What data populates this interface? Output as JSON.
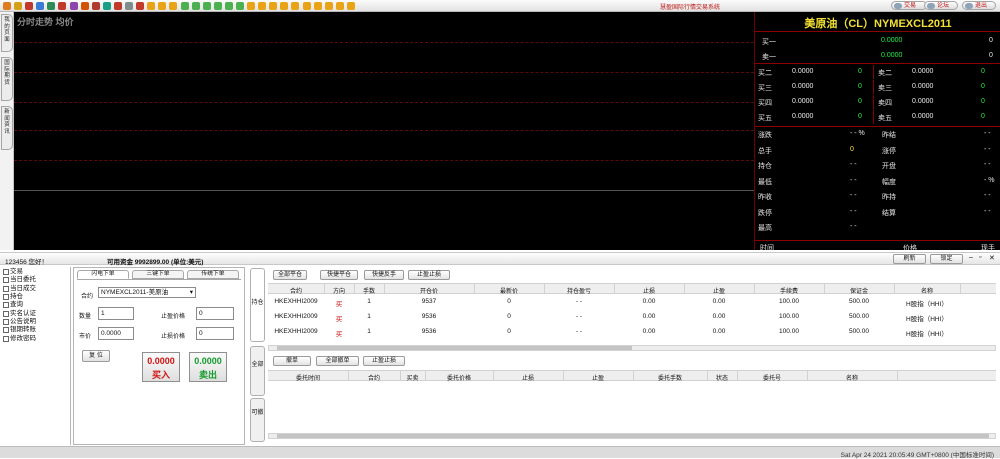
{
  "toolbar": {
    "system_title": "慧盈国际行情交易系统",
    "links": [
      {
        "label": "交易",
        "icon": "trade-icon"
      },
      {
        "label": "论坛",
        "icon": "forum-icon"
      },
      {
        "label": "退出",
        "icon": "exit-icon"
      }
    ]
  },
  "side_tabs": [
    "我的页面",
    "国际期货",
    "新闻资讯"
  ],
  "chart": {
    "title": "分时走势  均价"
  },
  "quote": {
    "title": "美原油（CL）NYMEXCL2011",
    "buy1": {
      "label": "买一",
      "price": "0.0000",
      "vol": "0"
    },
    "sell1": {
      "label": "卖一",
      "price": "0.0000",
      "vol": "0"
    },
    "depth": [
      {
        "bl": "买二",
        "bp": "0.0000",
        "bv": "0",
        "sl": "卖二",
        "sp": "0.0000",
        "sv": "0"
      },
      {
        "bl": "买三",
        "bp": "0.0000",
        "bv": "0",
        "sl": "卖三",
        "sp": "0.0000",
        "sv": "0"
      },
      {
        "bl": "买四",
        "bp": "0.0000",
        "bv": "0",
        "sl": "卖四",
        "sp": "0.0000",
        "sv": "0"
      },
      {
        "bl": "买五",
        "bp": "0.0000",
        "bv": "0",
        "sl": "卖五",
        "sp": "0.0000",
        "sv": "0"
      }
    ],
    "stats": [
      {
        "l1": "涨跌",
        "v1": "- - %",
        "l2": "昨结",
        "v2": "- -"
      },
      {
        "l1": "总手",
        "v1": "0",
        "l2": "涨停",
        "v2": "- -"
      },
      {
        "l1": "持仓",
        "v1": "- -",
        "l2": "开盘",
        "v2": "- -"
      },
      {
        "l1": "最低",
        "v1": "- -",
        "l2": "幅度",
        "v2": "- %"
      },
      {
        "l1": "昨收",
        "v1": "- -",
        "l2": "昨持",
        "v2": "- -"
      },
      {
        "l1": "跌停",
        "v1": "- -",
        "l2": "结算",
        "v2": "- -"
      },
      {
        "l1": "最高",
        "v1": "- -",
        "l2": "",
        "v2": ""
      }
    ],
    "tick_headers": [
      "时间",
      "价格",
      "现手"
    ]
  },
  "account": {
    "greeting": "123456 您好！",
    "funds": "可用资金 9992899.00 (单位:美元)",
    "refresh": "刷新",
    "lock": "锁定"
  },
  "tree": [
    "交易",
    "当日委托",
    "当日成交",
    "持仓",
    "查询",
    "实名认证",
    "公告说明",
    "银期转账",
    "修改密码"
  ],
  "order": {
    "tabs": [
      "闪电下单",
      "三键下单",
      "传统下单"
    ],
    "contract_label": "合约",
    "contract_value": "NYMEXCL2011-美原油",
    "qty_label": "数量",
    "qty_value": "1",
    "stop_label": "止盈价格",
    "stop_value": "0",
    "price_label": "市价",
    "price_value": "0.0000",
    "loss_label": "止损价格",
    "loss_value": "0",
    "reset": "复 位",
    "buy_price": "0.0000",
    "buy_label": "买入",
    "sell_price": "0.0000",
    "sell_label": "卖出"
  },
  "right_tabs": [
    "持仓",
    "全部",
    "可撤"
  ],
  "positions": {
    "buttons": [
      "全部平仓",
      "快捷平仓",
      "快捷反手",
      "止盈止损"
    ],
    "headers": [
      "合约",
      "方向",
      "手数",
      "开仓价",
      "最新价",
      "持仓盈亏",
      "止损",
      "止盈",
      "手续费",
      "保证金",
      "名称"
    ],
    "rows": [
      [
        "HKEXHHI2009",
        "买",
        "1",
        "9537",
        "0",
        "- -",
        "0.00",
        "0.00",
        "100.00",
        "500.00",
        "H股指（HHI）"
      ],
      [
        "HKEXHHI2009",
        "买",
        "1",
        "9536",
        "0",
        "- -",
        "0.00",
        "0.00",
        "100.00",
        "500.00",
        "H股指（HHI）"
      ],
      [
        "HKEXHHI2009",
        "买",
        "1",
        "9536",
        "0",
        "- -",
        "0.00",
        "0.00",
        "100.00",
        "500.00",
        "H股指（HHI）"
      ]
    ]
  },
  "orders": {
    "buttons": [
      "撤单",
      "全部撤单",
      "止盈止损"
    ],
    "headers": [
      "委托时间",
      "合约",
      "买卖",
      "委托价格",
      "止损",
      "止盈",
      "委托手数",
      "状态",
      "委托号",
      "名称"
    ]
  },
  "status": {
    "time": "Sat Apr 24 2021 20:05:49 GMT+0800 (中国标准时间)"
  },
  "colors": {
    "chart_bg": "#000000",
    "quote_title": "#f2e133",
    "price_green": "#22ee44",
    "buy_red": "#d01010"
  }
}
